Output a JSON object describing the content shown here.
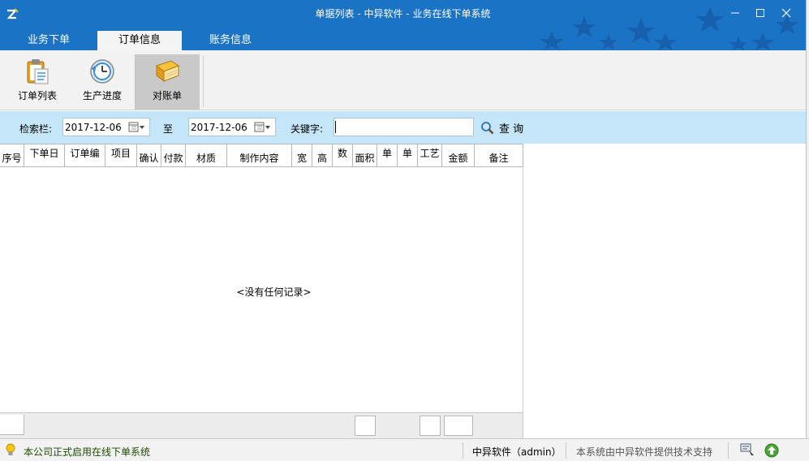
{
  "window": {
    "title": "单据列表 - 中异软件 - 业务在线下单系统"
  },
  "tabs": [
    {
      "label": "业务下单"
    },
    {
      "label": "订单信息"
    },
    {
      "label": "账务信息"
    }
  ],
  "toolbar": {
    "items": [
      {
        "label": "订单列表",
        "icon": "clipboard-icon"
      },
      {
        "label": "生产进度",
        "icon": "progress-icon"
      },
      {
        "label": "对账单",
        "icon": "book-icon"
      }
    ]
  },
  "search": {
    "filter_label": "检索栏:",
    "date_from": "2017-12-06",
    "to_label": "至",
    "date_to": "2017-12-06",
    "keyword_label": "关键字:",
    "keyword_value": "",
    "query_label": "查 询"
  },
  "grid": {
    "columns": [
      "序号",
      "下单日",
      "订单编",
      "项目",
      "确认",
      "付款",
      "材质",
      "制作内容",
      "宽",
      "高",
      "数",
      "面积",
      "单",
      "单",
      "工艺",
      "金额",
      "备注"
    ],
    "empty_message": "<没有任何记录>"
  },
  "statusbar": {
    "notice": "本公司正式启用在线下单系统",
    "company_user": "中异软件（admin）",
    "support": "本系统由中异软件提供技术支持"
  },
  "colors": {
    "title_blue": "#1a73c4",
    "search_bg": "#c5e6f8"
  }
}
